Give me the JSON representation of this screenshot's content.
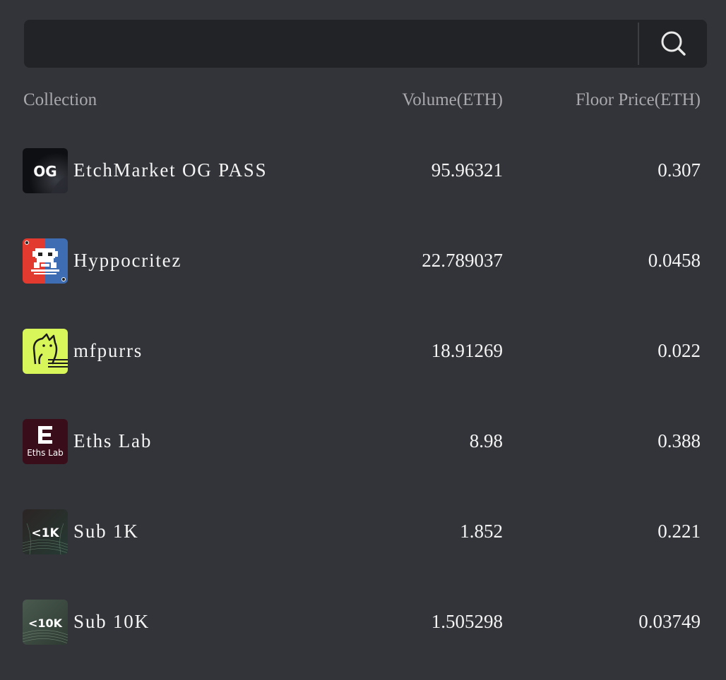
{
  "search": {
    "value": "",
    "placeholder": ""
  },
  "table": {
    "headers": {
      "collection": "Collection",
      "volume": "Volume(ETH)",
      "floor": "Floor Price(ETH)"
    },
    "rows": [
      {
        "name": "EtchMarket OG PASS",
        "volume": "95.96321",
        "floor": "0.307",
        "thumb_text": "OG",
        "icon": "og-pass-logo"
      },
      {
        "name": "Hyppocritez",
        "volume": "22.789037",
        "floor": "0.0458",
        "thumb_text": "",
        "icon": "hyppocritez-logo"
      },
      {
        "name": "mfpurrs",
        "volume": "18.91269",
        "floor": "0.022",
        "thumb_text": "",
        "icon": "mfpurrs-logo"
      },
      {
        "name": "Eths Lab",
        "volume": "8.98",
        "floor": "0.388",
        "thumb_text": "Eths Lab",
        "icon": "eths-lab-logo"
      },
      {
        "name": "Sub 1K",
        "volume": "1.852",
        "floor": "0.221",
        "thumb_text": "<1K",
        "icon": "sub-1k-logo"
      },
      {
        "name": "Sub 10K",
        "volume": "1.505298",
        "floor": "0.03749",
        "thumb_text": "<10K",
        "icon": "sub-10k-logo"
      }
    ]
  },
  "colors": {
    "background": "#333439",
    "search_bg": "#222327",
    "header_text": "#a9a9ad",
    "row_text": "#f4f4f4"
  }
}
